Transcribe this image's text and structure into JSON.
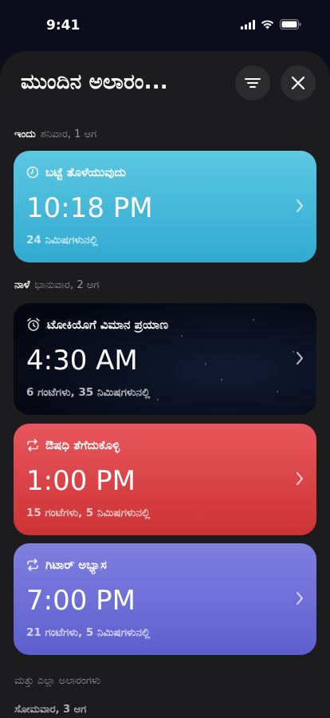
{
  "status_bar": {
    "time": "9:41"
  },
  "sheet": {
    "title": "ಮುಂದಿನ ಅಲಾರಂ..."
  },
  "sections": {
    "today": {
      "day": "ಇಂದು",
      "date": "ಶನಿವಾರ, 1 ಆಗ"
    },
    "tomorrow": {
      "day": "ನಾಳೆ",
      "date": "ಭಾನುವಾರ, 2 ಆಗ"
    },
    "others": {
      "label": "ಮತ್ತು ಎಲ್ಲಾ ಅಲಾರಂಗಳು"
    },
    "monday": {
      "label": "ಸೋಮವಾರ, 3 ಆಗ"
    }
  },
  "alarms": [
    {
      "title": "ಬಟ್ಟೆ ತೊಳೆಯುವುದು",
      "time": "10:18 PM",
      "subtitle": "24 ನಿಮಿಷಗಳುನಲ್ಲಿ",
      "icon": "clock-icon",
      "color": "#3fb6d8"
    },
    {
      "title": "ಟೋಕಿಯೊಗೆ ವಿಮಾನ ಪ್ರಯಾಣ",
      "time": "4:30 AM",
      "subtitle": "6 ಗಂಟೆಗಳು, 35 ನಿಮಿಷಗಳುನಲ್ಲಿ",
      "icon": "alarm-clock-icon",
      "color": "#0a0f20"
    },
    {
      "title": "ಔಷಧಿ ತೆಗೆದುಕೊಳ್ಳಿ",
      "time": "1:00 PM",
      "subtitle": "15 ಗಂಟೆಗಳು, 5 ನಿಮಿಷಗಳುನಲ್ಲಿ",
      "icon": "repeat-icon",
      "color": "#d9403f"
    },
    {
      "title": "ಗಿಟಾರ್ ಅಭ್ಯಾಸ",
      "time": "7:00 PM",
      "subtitle": "21 ಗಂಟೆಗಳು, 5 ನಿಮಿಷಗಳುನಲ್ಲಿ",
      "icon": "repeat-icon",
      "color": "#6a6bd6"
    }
  ]
}
